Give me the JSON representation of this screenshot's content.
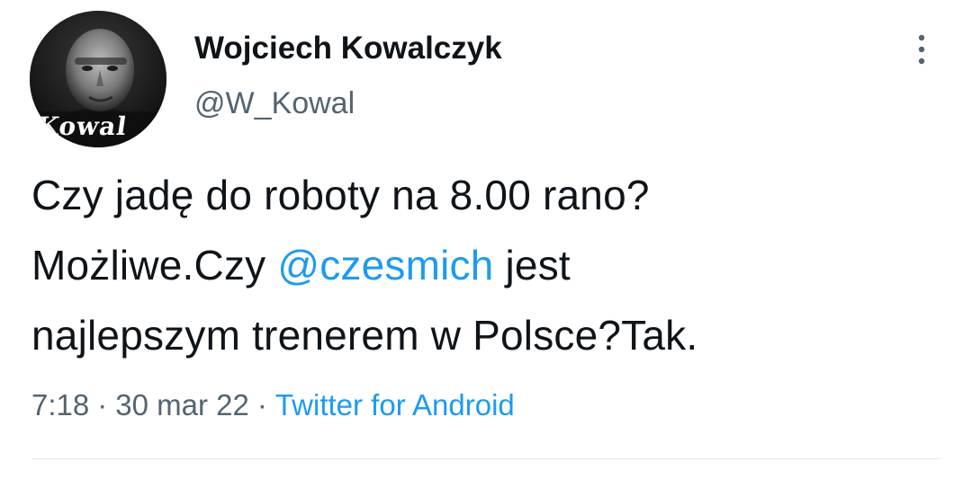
{
  "author": {
    "display_name": "Wojciech Kowalczyk",
    "handle": "@W_Kowal",
    "avatar_caption": "Kowal"
  },
  "tweet": {
    "line1": "Czy jadę do roboty na 8.00 rano?",
    "line2_before": "Możliwe.Czy ",
    "mention": "@czesmich",
    "line2_after": " jest",
    "line3": "najlepszym trenerem w Polsce?Tak."
  },
  "meta": {
    "time": "7:18",
    "separator": "·",
    "date": "30 mar 22",
    "source": "Twitter for Android"
  },
  "icons": {
    "more": "more-vertical-icon"
  },
  "colors": {
    "text": "#0f1419",
    "secondary": "#536471",
    "link": "#1d9bf0"
  }
}
